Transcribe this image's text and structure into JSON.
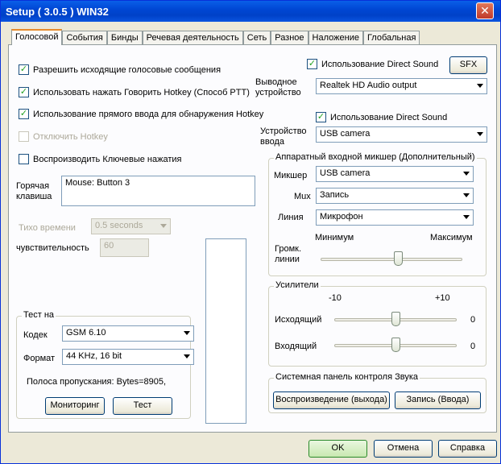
{
  "window": {
    "title": "Setup ( 3.0.5 ) WIN32",
    "close_label": "✕"
  },
  "tabs": [
    "Голосовой",
    "События",
    "Бинды",
    "Речевая деятельность",
    "Сеть",
    "Разное",
    "Наложение",
    "Глобальная"
  ],
  "active_tab": "Голосовой",
  "left": {
    "allow_outgoing": {
      "label": "Разрешить исходящие голосовые сообщения",
      "checked": true
    },
    "ptt_hotkey": {
      "label": "Использовать нажать Говорить Hotkey (Способ PTT)",
      "checked": true
    },
    "direct_input": {
      "label": "Использование прямого ввода для обнаружения Hotkey",
      "checked": true
    },
    "disable_hotkey": {
      "label": "Отключить Hotkey",
      "checked": false,
      "disabled": true
    },
    "play_keypress": {
      "label": "Воспроизводить Ключевые нажатия",
      "checked": false
    },
    "hotkey_label": "Горячая клавиша",
    "hotkey_value": "Mouse: Button 3",
    "silence_label": "Тихо времени",
    "silence_value": "0.5 seconds",
    "sensitivity_label": "чувствительность",
    "sensitivity_value": "60"
  },
  "test": {
    "group_label": "Тест на",
    "codec_label": "Кодек",
    "codec_value": "GSM 6.10",
    "format_label": "Формат",
    "format_value": "44 KHz, 16 bit",
    "bandwidth_text": "Полоса пропускания:  Bytes=8905,",
    "monitor_button": "Мониторинг",
    "test_button": "Тест"
  },
  "output": {
    "direct_sound": {
      "label": "Использование Direct Sound",
      "checked": true
    },
    "sfx_button": "SFX",
    "device_label": "Выводное устройство",
    "device_value": "Realtek HD Audio output"
  },
  "input": {
    "direct_sound": {
      "label": "Использование Direct Sound",
      "checked": true
    },
    "device_label": "Устройство ввода",
    "device_value": "USB camera"
  },
  "mixer": {
    "group_label": "Аппаратный входной микшер (Дополнительный)",
    "mixer_label": "Микшер",
    "mixer_value": "USB camera",
    "mux_label": "Mux",
    "mux_value": "Запись",
    "line_label": "Линия",
    "line_value": "Микрофон",
    "min_label": "Минимум",
    "max_label": "Максимум",
    "volume_label": "Громк. линии",
    "volume_level": 0.55
  },
  "amps": {
    "group_label": "Усилители",
    "min_label": "-10",
    "max_label": "+10",
    "outgoing_label": "Исходящий",
    "outgoing_value": "0",
    "outgoing_level": 0.5,
    "incoming_label": "Входящий",
    "incoming_value": "0",
    "incoming_level": 0.5
  },
  "sound_panel": {
    "group_label": "Системная панель контроля Звука",
    "playback_button": "Воспроизведение (выхода)",
    "record_button": "Запись (Ввода)"
  },
  "footer": {
    "ok": "OK",
    "cancel": "Отмена",
    "help": "Справка"
  },
  "colors": {
    "title_bar": "#0047d4",
    "check_mark": "#21a121",
    "active_tab_accent": "#e68b2c"
  }
}
